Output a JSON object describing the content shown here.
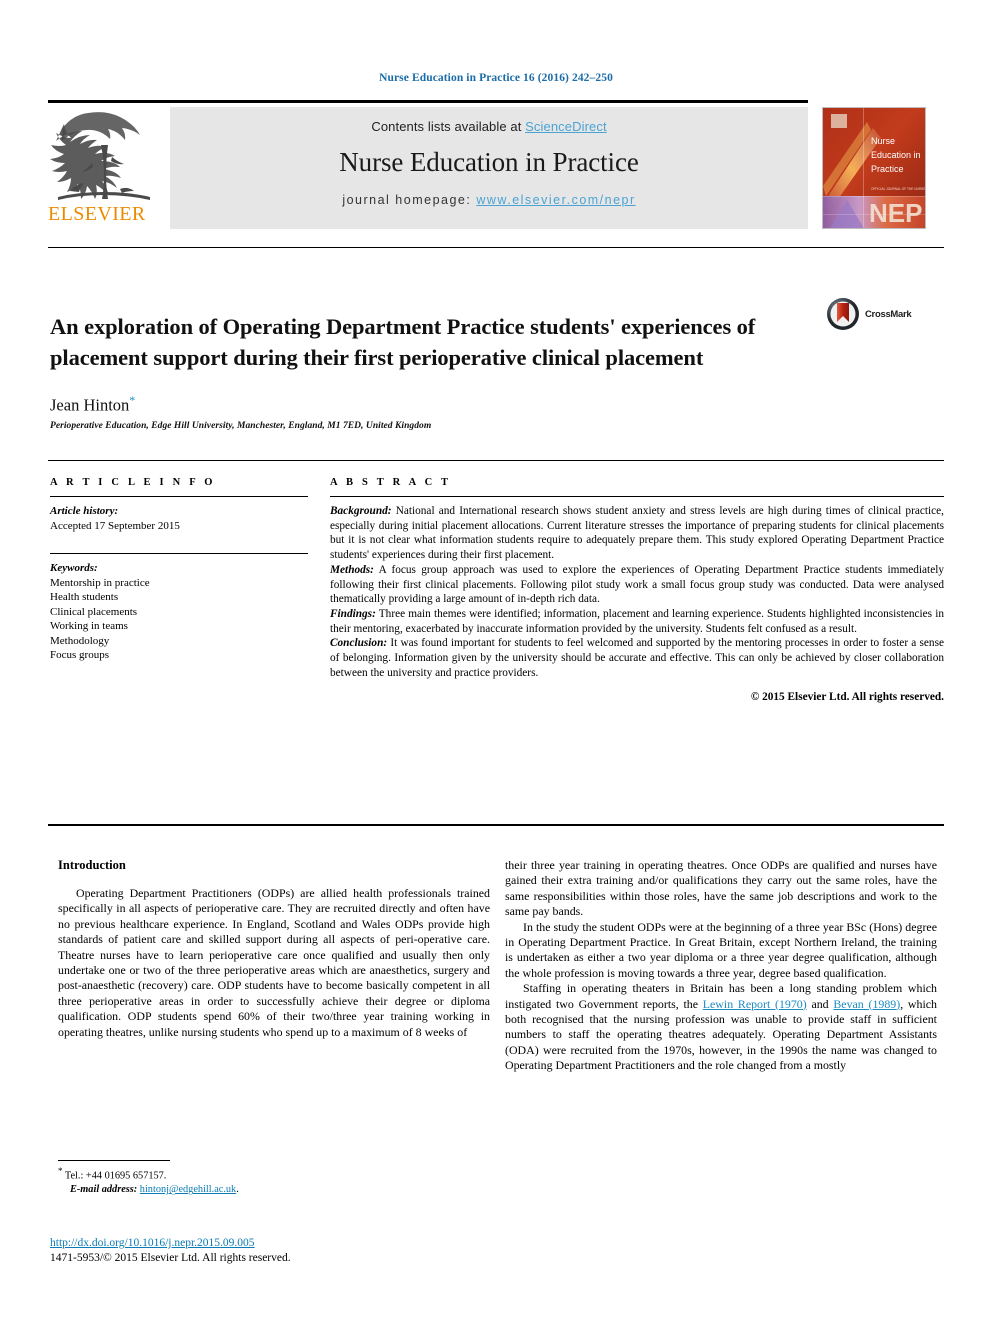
{
  "running_head": "Nurse Education in Practice 16 (2016) 242–250",
  "masthead": {
    "publisher_name": "ELSEVIER",
    "contents_prefix": "Contents lists available at ",
    "contents_link": "ScienceDirect",
    "journal_name": "Nurse Education in Practice",
    "homepage_prefix": "journal homepage: ",
    "homepage_link": "www.elsevier.com/nepr",
    "cover_title_line1": "Nurse",
    "cover_title_line2": "Education in",
    "cover_title_line3": "Practice",
    "cover_badge": "NEP",
    "accent_orange": "#ED8B00",
    "link_blue": "#4ba3d3",
    "banner_bg": "#e6e6e6"
  },
  "title_block": {
    "title": "An exploration of Operating Department Practice students' experiences of placement support during their first perioperative clinical placement",
    "author": "Jean Hinton",
    "author_marker": "*",
    "affiliation": "Perioperative Education, Edge Hill University, Manchester, England, M1 7ED, United Kingdom",
    "crossmark_label": "CrossMark"
  },
  "article_info": {
    "heading": "A R T I C L E   I N F O",
    "history_label": "Article history:",
    "history_value": "Accepted 17 September 2015",
    "keywords_label": "Keywords:",
    "keywords": [
      "Mentorship in practice",
      "Health students",
      "Clinical placements",
      "Working in teams",
      "Methodology",
      "Focus groups"
    ]
  },
  "abstract": {
    "heading": "A B S T R A C T",
    "sections": [
      {
        "lead": "Background:",
        "text": " National and International research shows student anxiety and stress levels are high during times of clinical practice, especially during initial placement allocations. Current literature stresses the importance of preparing students for clinical placements but it is not clear what information students require to adequately prepare them. This study explored Operating Department Practice students' experiences during their first placement."
      },
      {
        "lead": "Methods:",
        "text": " A focus group approach was used to explore the experiences of Operating Department Practice students immediately following their first clinical placements. Following pilot study work a small focus group study was conducted. Data were analysed thematically providing a large amount of in-depth rich data."
      },
      {
        "lead": "Findings:",
        "text": " Three main themes were identified; information, placement and learning experience. Students highlighted inconsistencies in their mentoring, exacerbated by inaccurate information provided by the university. Students felt confused as a result."
      },
      {
        "lead": "Conclusion:",
        "text": " It was found important for students to feel welcomed and supported by the mentoring processes in order to foster a sense of belonging. Information given by the university should be accurate and effective. This can only be achieved by closer collaboration between the university and practice providers."
      }
    ],
    "copyright": "© 2015 Elsevier Ltd. All rights reserved."
  },
  "body": {
    "section_heading": "Introduction",
    "left_paragraphs": [
      "Operating Department Practitioners (ODPs) are allied health professionals trained specifically in all aspects of perioperative care. They are recruited directly and often have no previous healthcare experience. In England, Scotland and Wales ODPs provide high standards of patient care and skilled support during all aspects of peri-operative care. Theatre nurses have to learn perioperative care once qualified and usually then only undertake one or two of the three perioperative areas which are anaesthetics, surgery and post-anaesthetic (recovery) care. ODP students have to become basically competent in all three perioperative areas in order to successfully achieve their degree or diploma qualification. ODP students spend 60% of their two/three year training working in operating theatres, unlike nursing students who spend up to a maximum of 8 weeks of"
    ],
    "right_paragraph_1": "their three year training in operating theatres. Once ODPs are qualified and nurses have gained their extra training and/or qualifications they carry out the same roles, have the same responsibilities within those roles, have the same job descriptions and work to the same pay bands.",
    "right_paragraph_2": "In the study the student ODPs were at the beginning of a three year BSc (Hons) degree in Operating Department Practice. In Great Britain, except Northern Ireland, the training is undertaken as either a two year diploma or a three year degree qualification, although the whole profession is moving towards a three year, degree based qualification.",
    "right_paragraph_3_part1": "Staffing in operating theaters in Britain has been a long standing problem which instigated two Government reports, the ",
    "right_citation_1": "Lewin Report (1970)",
    "right_paragraph_3_part2": " and ",
    "right_citation_2": "Bevan (1989)",
    "right_paragraph_3_part3": ", which both recognised that the nursing profession was unable to provide staff in sufficient numbers to staff the operating theatres adequately. Operating Department Assistants (ODA) were recruited from the 1970s, however, in the 1990s the name was changed to Operating Department Practitioners and the role changed from a mostly"
  },
  "footnote": {
    "marker": "*",
    "tel": " Tel.: +44 01695 657157.",
    "email_label": "E-mail address:",
    "email": "hintonj@edgehill.ac.uk",
    "email_suffix": "."
  },
  "footer": {
    "doi": "http://dx.doi.org/10.1016/j.nepr.2015.09.005",
    "issn": "1471-5953/© 2015 Elsevier Ltd. All rights reserved."
  }
}
